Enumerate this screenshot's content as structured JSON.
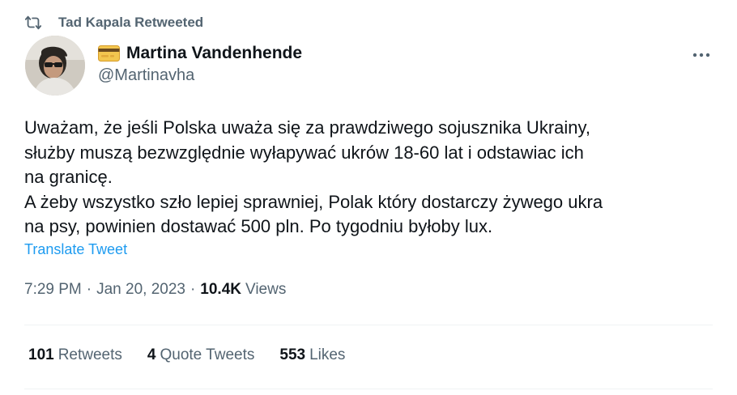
{
  "retweet_header": {
    "icon": "retweet-icon",
    "text": "Tad Kapala Retweeted"
  },
  "author": {
    "name_emoji": "credit-card-emoji",
    "display_name": "Martina Vandenhende",
    "handle": "@Martinavha"
  },
  "more_button_icon": "more-horizontal-icon",
  "tweet": {
    "lines": [
      "Uważam, że jeśli Polska uważa się za prawdziwego sojusznika Ukrainy,",
      "służby muszą bezwzględnie wyłapywać ukrów 18-60 lat i odstawiac ich",
      "na granicę.",
      "A żeby wszystko szło lepiej sprawniej, Polak który dostarczy żywego ukra",
      "na psy, powinien dostawać 500 pln. Po tygodniu byłoby lux."
    ],
    "translate_label": "Translate Tweet"
  },
  "meta": {
    "time": "7:29 PM",
    "separator": "·",
    "date": "Jan 20, 2023",
    "views_count": "10.4K",
    "views_label": "Views"
  },
  "stats": {
    "retweets_count": "101",
    "retweets_label": "Retweets",
    "quotes_count": "4",
    "quotes_label": "Quote Tweets",
    "likes_count": "553",
    "likes_label": "Likes"
  },
  "colors": {
    "text_primary": "#0f1419",
    "text_secondary": "#536471",
    "link": "#1d9bf0",
    "divider": "#eff3f4"
  }
}
